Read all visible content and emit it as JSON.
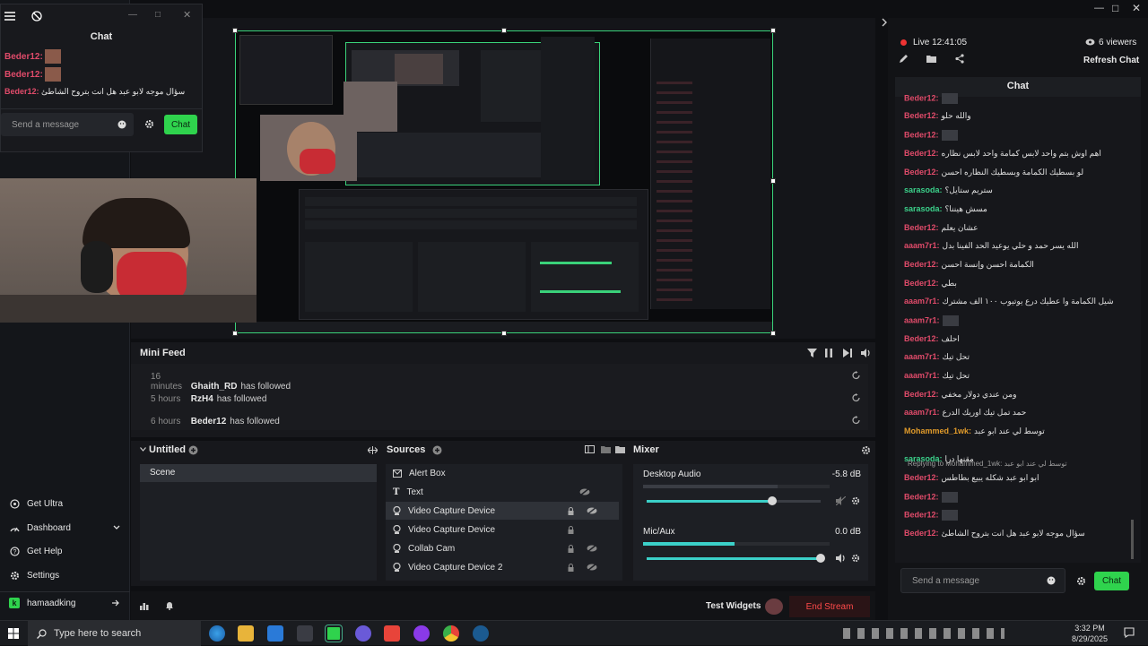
{
  "colors": {
    "accent_green": "#2fd34d",
    "end_stream": "#e03c3c",
    "username_red": "#e04b6a",
    "username_green": "#3bd08a",
    "username_orange": "#e09a2a",
    "live_dot": "#e33"
  },
  "chat_popup": {
    "title": "Chat",
    "messages": [
      {
        "user": "Beder12:",
        "text": ""
      },
      {
        "user": "Beder12:",
        "text": ""
      },
      {
        "user": "Beder12:",
        "text": "سؤال موجه لابو عبد هل انت بتروح الشاطئ"
      }
    ],
    "input_placeholder": "Send a message",
    "chat_button": "Chat"
  },
  "sidebar": {
    "items": [
      {
        "label": "Get Ultra",
        "icon": "ultra-icon"
      },
      {
        "label": "Dashboard",
        "icon": "dashboard-icon"
      },
      {
        "label": "Get Help",
        "icon": "help-icon"
      },
      {
        "label": "Settings",
        "icon": "gear-icon"
      }
    ],
    "user": "hamaadking"
  },
  "mini_feed": {
    "title": "Mini Feed",
    "rows": [
      {
        "time": "16 minutes",
        "name": "Ghaith_RD",
        "action": "has followed"
      },
      {
        "time": "5 hours",
        "name": "RzH4",
        "action": "has followed"
      },
      {
        "time": "6 hours",
        "name": "Beder12",
        "action": "has followed"
      }
    ]
  },
  "scenes": {
    "title": "Untitled",
    "items": [
      "Scene"
    ]
  },
  "sources": {
    "title": "Sources",
    "items": [
      "Alert Box",
      "Text",
      "Video Capture Device",
      "Video Capture Device",
      "Collab Cam",
      "Video Capture Device 2"
    ]
  },
  "mixer": {
    "title": "Mixer",
    "channels": [
      {
        "name": "Desktop Audio",
        "db": "-5.8 dB",
        "level": 0.72
      },
      {
        "name": "Mic/Aux",
        "db": "0.0 dB",
        "level": 1.0
      }
    ]
  },
  "footer": {
    "test_widgets": "Test Widgets",
    "end_stream": "End Stream"
  },
  "right_panel": {
    "live_label": "Live 12:41:05",
    "viewers": "6 viewers",
    "refresh_chat": "Refresh Chat",
    "chat_title": "Chat",
    "input_placeholder": "Send a message",
    "chat_button": "Chat",
    "messages": [
      {
        "user": "Beder12:",
        "text": "",
        "color": "red"
      },
      {
        "user": "Beder12:",
        "text": "والله حلو",
        "color": "red"
      },
      {
        "user": "Beder12:",
        "text": "",
        "color": "red"
      },
      {
        "user": "Beder12:",
        "text": "اهم اوش بتم واحد لابس كمامة واحد لابس نظاره",
        "color": "red"
      },
      {
        "user": "Beder12:",
        "text": "لو بسطيك الكمامة وبسطيك النظاره احسن",
        "color": "red"
      },
      {
        "user": "sarasoda:",
        "text": "ستريم ستايل؟",
        "color": "green"
      },
      {
        "user": "sarasoda:",
        "text": "مسش هيننا؟",
        "color": "green"
      },
      {
        "user": "Beder12:",
        "text": "عشان يعلم",
        "color": "red"
      },
      {
        "user": "aaam7r1:",
        "text": "الله يسر حمد و حلي يوعيد الحد الفينا بدل",
        "color": "red"
      },
      {
        "user": "Beder12:",
        "text": "الكمامة احسن وإنسة احسن",
        "color": "red"
      },
      {
        "user": "Beder12:",
        "text": "بطي",
        "color": "red"
      },
      {
        "user": "aaam7r1:",
        "text": "شيل الكمامة وا عطيك درع يوتيوب ١٠٠ الف مشترك",
        "color": "red"
      },
      {
        "user": "aaam7r1:",
        "text": "",
        "color": "red"
      },
      {
        "user": "Beder12:",
        "text": "احلف",
        "color": "red"
      },
      {
        "user": "aaam7r1:",
        "text": "تحل تيك",
        "color": "red"
      },
      {
        "user": "aaam7r1:",
        "text": "تحل تيك",
        "color": "red"
      },
      {
        "user": "Beder12:",
        "text": "ومن عندي دولار مخفي",
        "color": "red"
      },
      {
        "user": "aaam7r1:",
        "text": "حمد تمل تيك اوريك الدرع",
        "color": "red"
      },
      {
        "user": "Mohammed_1wk:",
        "text": "توسط لي عند ابو عبد",
        "color": "orange"
      },
      {
        "user": "sarasoda:",
        "text": "مقنها درا",
        "color": "green"
      },
      {
        "user": "Beder12:",
        "text": "ابو ابو عبد شكله يبيع بطاطس",
        "color": "red"
      },
      {
        "user": "Beder12:",
        "text": "",
        "color": "red"
      },
      {
        "user": "Beder12:",
        "text": "",
        "color": "red"
      },
      {
        "user": "Beder12:",
        "text": "سؤال موجه لابو عبد هل انت بتروح الشاطئ",
        "color": "red"
      }
    ],
    "reply_note": "Replying to Mohammed_1wk: توسط لي عند ابو عبد"
  },
  "taskbar": {
    "search_placeholder": "Type here to search",
    "time": "3:32 PM",
    "date": "8/29/2025"
  }
}
